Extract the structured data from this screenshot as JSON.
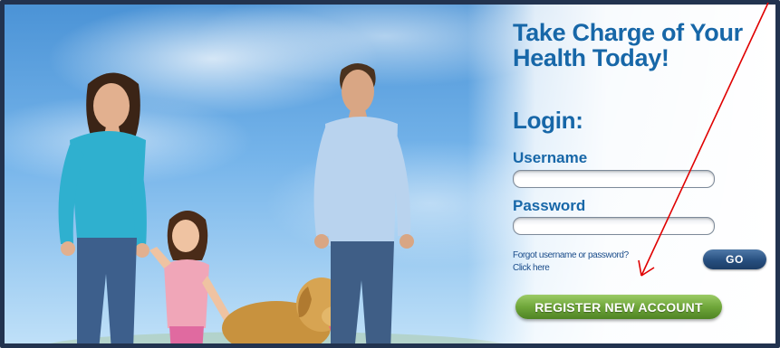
{
  "headline": {
    "line1": "Take Charge of Your",
    "line2": "Health Today!"
  },
  "login": {
    "title": "Login:",
    "username_label": "Username",
    "username_value": "",
    "password_label": "Password",
    "password_value": "",
    "forgot_line1": "Forgot username or password?",
    "forgot_line2": "Click here",
    "go_label": "GO",
    "register_label": "REGISTER NEW ACCOUNT"
  },
  "colors": {
    "headline_blue": "#1767a8",
    "go_button": "#274f7f",
    "register_button": "#6fa63a",
    "annotation_arrow": "#e00000",
    "frame_border": "#22334f"
  },
  "icons": {
    "annotation": "red-arrow-icon"
  }
}
